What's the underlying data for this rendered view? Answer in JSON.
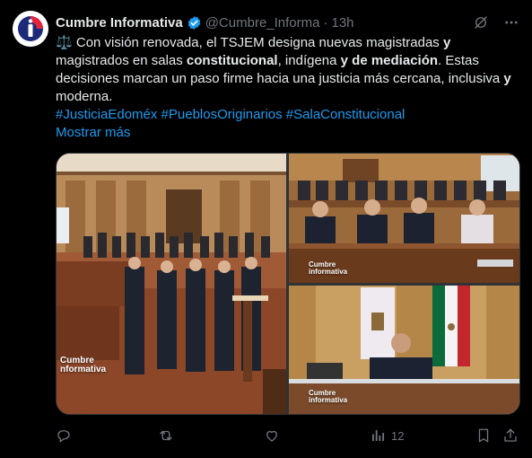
{
  "author": {
    "name": "Cumbre Informativa",
    "handle": "@Cumbre_Informa",
    "separator": "·",
    "time": "13h"
  },
  "post": {
    "emoji": "⚖️",
    "seg1": " Con visión renovada, el TSJEM designa nuevas magistradas ",
    "seg2": "y",
    "seg3": " magistrados en salas ",
    "seg4": "constitucional",
    "seg5": ", indígena ",
    "seg6": "y de mediación",
    "seg7": ". Estas decisiones marcan un paso firme hacia una justicia más cercana, inclusiva ",
    "seg8": "y",
    "seg9": " moderna.",
    "hashtags": "#JusticiaEdoméx #PueblosOriginarios #SalaConstitucional",
    "show_more": "Mostrar más"
  },
  "media": {
    "watermark_1": "Cumbre",
    "watermark_2": "nformativa",
    "watermark_small_1": "Cumbre",
    "watermark_small_2": "informativa"
  },
  "actions": {
    "views": "12"
  },
  "colors": {
    "background": "#000000",
    "text": "#e7e9ea",
    "muted": "#71767b",
    "link": "#1d9bf0",
    "verified": "#1d9bf0"
  }
}
